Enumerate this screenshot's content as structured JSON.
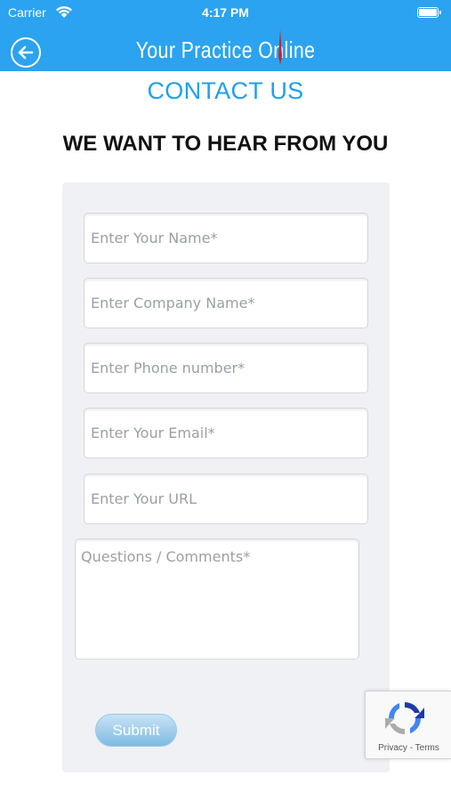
{
  "status_bar": {
    "carrier": "Carrier",
    "time": "4:17 PM",
    "wifi_icon": "wifi-icon",
    "battery_icon": "battery-icon"
  },
  "nav_bar": {
    "back_icon": "arrow-left-circle-icon",
    "brand": "Your Practice Online",
    "background_color": "#2ba3f0"
  },
  "page": {
    "heading": "CONTACT US",
    "subheading": "WE WANT TO HEAR FROM YOU",
    "heading_color": "#1fa0ef"
  },
  "form": {
    "fields": [
      {
        "placeholder": "Enter Your Name*",
        "value": ""
      },
      {
        "placeholder": "Enter Company Name*",
        "value": ""
      },
      {
        "placeholder": "Enter Phone number*",
        "value": ""
      },
      {
        "placeholder": "Enter Your Email*",
        "value": ""
      },
      {
        "placeholder": "Enter Your URL",
        "value": ""
      }
    ],
    "comments": {
      "placeholder": "Questions / Comments*",
      "value": ""
    },
    "submit_label": "Submit"
  },
  "recaptcha": {
    "icon": "recaptcha-icon",
    "privacy": "Privacy",
    "separator": " - ",
    "terms": "Terms"
  }
}
